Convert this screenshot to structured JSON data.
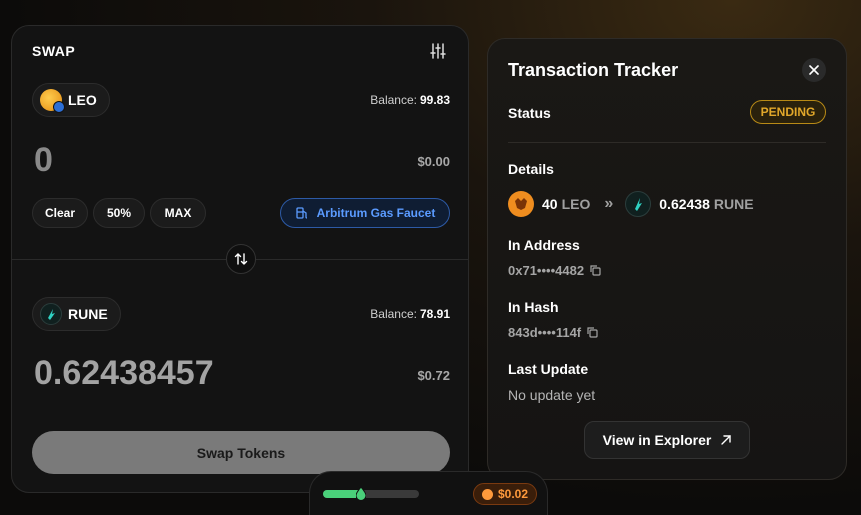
{
  "swap": {
    "title": "SWAP",
    "from": {
      "symbol": "LEO",
      "balance_label": "Balance:",
      "balance": "99.83",
      "amount": "0",
      "usd": "$0.00"
    },
    "quick": {
      "clear": "Clear",
      "half": "50%",
      "max": "MAX"
    },
    "faucet_label": "Arbitrum Gas Faucet",
    "to": {
      "symbol": "RUNE",
      "balance_label": "Balance:",
      "balance": "78.91",
      "amount": "0.62438457",
      "usd": "$0.72"
    },
    "button": "Swap Tokens"
  },
  "tracker": {
    "title": "Transaction Tracker",
    "status_label": "Status",
    "status": "PENDING",
    "details_label": "Details",
    "from_amount": "40",
    "from_symbol": "LEO",
    "arrow": "»",
    "to_amount": "0.62438",
    "to_symbol": "RUNE",
    "in_address_label": "In Address",
    "in_address": "0x71••••4482",
    "in_hash_label": "In Hash",
    "in_hash": "843d••••114f",
    "last_update_label": "Last Update",
    "last_update": "No update yet",
    "explorer_button": "View in Explorer"
  },
  "gas": {
    "level": 0.4,
    "fee": "$0.02"
  },
  "colors": {
    "pending": "#e2a82a",
    "faucet": "#5b9bff",
    "gas": "#4ad07a",
    "fee": "#ff9a3c"
  }
}
